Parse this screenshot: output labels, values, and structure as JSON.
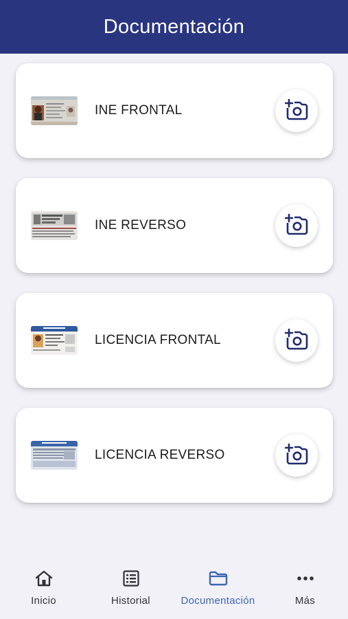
{
  "header": {
    "title": "Documentación"
  },
  "documents": [
    {
      "label": "INE FRONTAL",
      "thumb_icon": "ine-front-thumbnail",
      "action_icon": "add-photo-icon"
    },
    {
      "label": "INE REVERSO",
      "thumb_icon": "ine-back-thumbnail",
      "action_icon": "add-photo-icon"
    },
    {
      "label": "LICENCIA FRONTAL",
      "thumb_icon": "license-front-thumbnail",
      "action_icon": "add-photo-icon"
    },
    {
      "label": "LICENCIA REVERSO",
      "thumb_icon": "license-back-thumbnail",
      "action_icon": "add-photo-icon"
    }
  ],
  "nav": {
    "items": [
      {
        "label": "Inicio",
        "icon": "home-icon"
      },
      {
        "label": "Historial",
        "icon": "list-icon"
      },
      {
        "label": "Documentación",
        "icon": "folder-icon",
        "active": true
      },
      {
        "label": "Más",
        "icon": "more-icon"
      }
    ]
  },
  "colors": {
    "header_bg": "#2a3580",
    "accent": "#3b66b5",
    "icon_dark": "#1f2a6e",
    "background": "#f2f1f7"
  }
}
